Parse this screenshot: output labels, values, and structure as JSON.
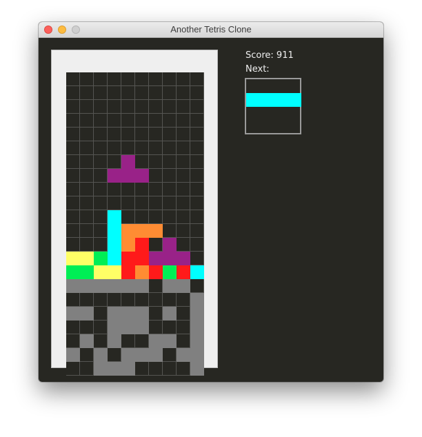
{
  "window": {
    "title": "Another Tetris Clone"
  },
  "hud": {
    "score_label": "Score: 911",
    "next_label": "Next:"
  },
  "colors": {
    "background": "#272722",
    "Y": "#ffff66",
    "G": "#00ee55",
    "C": "#00ffff",
    "O": "#ff8c33",
    "R": "#ff1a1a",
    "P": "#992288",
    "X": "#808080"
  },
  "board": {
    "columns": 10,
    "rows": 22,
    "active_piece": {
      "shape": "T",
      "color_key": "P",
      "cells": [
        [
          6,
          4
        ],
        [
          7,
          3
        ],
        [
          7,
          4
        ],
        [
          7,
          5
        ]
      ]
    },
    "grid": [
      "..........",
      "..........",
      "..........",
      "..........",
      "..........",
      "..........",
      "..........",
      "..........",
      "..........",
      "..........",
      "...C......",
      "...COOO...",
      "...COR.P..",
      "YYGCRRPPP.",
      "GGYYRORGRC",
      "XXXXXX.XX.",
      ".........X",
      "XX.XXX.X.X",
      "...XXX...X",
      ".X.X..XX.X",
      "X.X.XXX.XX",
      "..XXX....X"
    ]
  },
  "next_piece": {
    "shape": "I",
    "color_key": "C"
  }
}
